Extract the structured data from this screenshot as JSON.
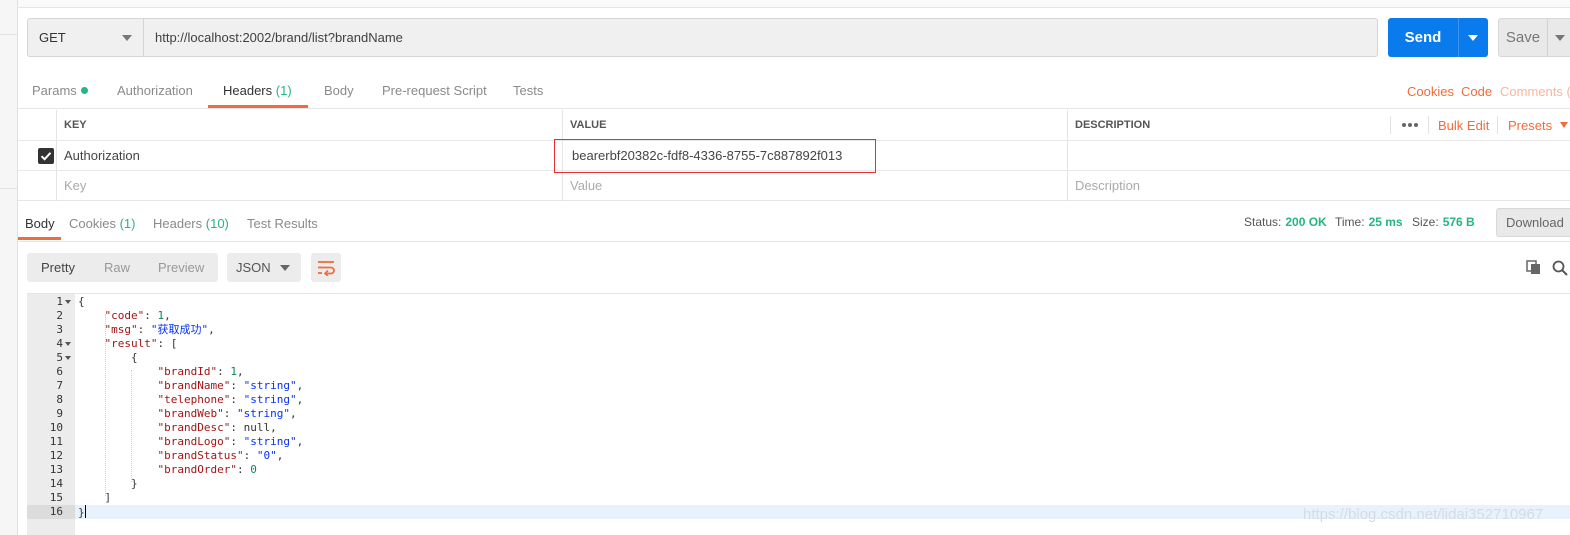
{
  "request": {
    "method": "GET",
    "url": "http://localhost:2002/brand/list?brandName",
    "send_label": "Send",
    "save_label": "Save"
  },
  "request_tabs": [
    {
      "label": "Params"
    },
    {
      "label": "Authorization"
    },
    {
      "label": "Headers",
      "count": "(1)"
    },
    {
      "label": "Body"
    },
    {
      "label": "Pre-request Script"
    },
    {
      "label": "Tests"
    }
  ],
  "request_links": {
    "cookies": "Cookies",
    "code": "Code",
    "comments": "Comments ("
  },
  "headers_table": {
    "columns": {
      "key": "KEY",
      "value": "VALUE",
      "description": "DESCRIPTION"
    },
    "bulk_edit": "Bulk Edit",
    "presets": "Presets",
    "rows": [
      {
        "checked": true,
        "key": "Authorization",
        "value": "bearerbf20382c-fdf8-4336-8755-7c887892f013",
        "description": ""
      }
    ],
    "placeholder": {
      "key": "Key",
      "value": "Value",
      "description": "Description"
    }
  },
  "response_tabs": [
    {
      "label": "Body"
    },
    {
      "label": "Cookies",
      "count": "(1)"
    },
    {
      "label": "Headers",
      "count": "(10)"
    },
    {
      "label": "Test Results"
    }
  ],
  "response_status": {
    "status_label": "Status:",
    "status_value": "200 OK",
    "time_label": "Time:",
    "time_value": "25 ms",
    "size_label": "Size:",
    "size_value": "576 B",
    "download_label": "Download"
  },
  "format_bar": {
    "pretty": "Pretty",
    "raw": "Raw",
    "preview": "Preview",
    "language": "JSON"
  },
  "code_lines": [
    {
      "n": "1",
      "fold": true,
      "indent": 0,
      "parts": [
        [
          "p",
          "{"
        ]
      ]
    },
    {
      "n": "2",
      "fold": false,
      "indent": 1,
      "parts": [
        [
          "k",
          "\"code\""
        ],
        [
          "p",
          ": "
        ],
        [
          "n",
          "1"
        ],
        [
          "p",
          ","
        ]
      ]
    },
    {
      "n": "3",
      "fold": false,
      "indent": 1,
      "parts": [
        [
          "k",
          "\"msg\""
        ],
        [
          "p",
          ": "
        ],
        [
          "s",
          "\"获取成功\""
        ],
        [
          "p",
          ","
        ]
      ]
    },
    {
      "n": "4",
      "fold": true,
      "indent": 1,
      "parts": [
        [
          "k",
          "\"result\""
        ],
        [
          "p",
          ": ["
        ]
      ]
    },
    {
      "n": "5",
      "fold": true,
      "indent": 2,
      "parts": [
        [
          "p",
          "{"
        ]
      ]
    },
    {
      "n": "6",
      "fold": false,
      "indent": 3,
      "parts": [
        [
          "k",
          "\"brandId\""
        ],
        [
          "p",
          ": "
        ],
        [
          "n",
          "1"
        ],
        [
          "p",
          ","
        ]
      ]
    },
    {
      "n": "7",
      "fold": false,
      "indent": 3,
      "parts": [
        [
          "k",
          "\"brandName\""
        ],
        [
          "p",
          ": "
        ],
        [
          "s",
          "\"string\""
        ],
        [
          "p",
          ","
        ]
      ]
    },
    {
      "n": "8",
      "fold": false,
      "indent": 3,
      "parts": [
        [
          "k",
          "\"telephone\""
        ],
        [
          "p",
          ": "
        ],
        [
          "s",
          "\"string\""
        ],
        [
          "p",
          ","
        ]
      ]
    },
    {
      "n": "9",
      "fold": false,
      "indent": 3,
      "parts": [
        [
          "k",
          "\"brandWeb\""
        ],
        [
          "p",
          ": "
        ],
        [
          "s",
          "\"string\""
        ],
        [
          "p",
          ","
        ]
      ]
    },
    {
      "n": "10",
      "fold": false,
      "indent": 3,
      "parts": [
        [
          "k",
          "\"brandDesc\""
        ],
        [
          "p",
          ": "
        ],
        [
          "l",
          "null"
        ],
        [
          "p",
          ","
        ]
      ]
    },
    {
      "n": "11",
      "fold": false,
      "indent": 3,
      "parts": [
        [
          "k",
          "\"brandLogo\""
        ],
        [
          "p",
          ": "
        ],
        [
          "s",
          "\"string\""
        ],
        [
          "p",
          ","
        ]
      ]
    },
    {
      "n": "12",
      "fold": false,
      "indent": 3,
      "parts": [
        [
          "k",
          "\"brandStatus\""
        ],
        [
          "p",
          ": "
        ],
        [
          "s",
          "\"0\""
        ],
        [
          "p",
          ","
        ]
      ]
    },
    {
      "n": "13",
      "fold": false,
      "indent": 3,
      "parts": [
        [
          "k",
          "\"brandOrder\""
        ],
        [
          "p",
          ": "
        ],
        [
          "n",
          "0"
        ]
      ]
    },
    {
      "n": "14",
      "fold": false,
      "indent": 2,
      "parts": [
        [
          "p",
          "}"
        ]
      ]
    },
    {
      "n": "15",
      "fold": false,
      "indent": 1,
      "parts": [
        [
          "p",
          "]"
        ]
      ]
    },
    {
      "n": "16",
      "fold": false,
      "indent": 0,
      "current": true,
      "parts": [
        [
          "p",
          "}"
        ]
      ]
    }
  ],
  "watermark": "https://blog.csdn.net/lidai352710967",
  "colors": {
    "accent_orange": "#f26b3a",
    "send_blue": "#097bed",
    "success_green": "#26b47f",
    "highlight_red": "#e23131"
  }
}
